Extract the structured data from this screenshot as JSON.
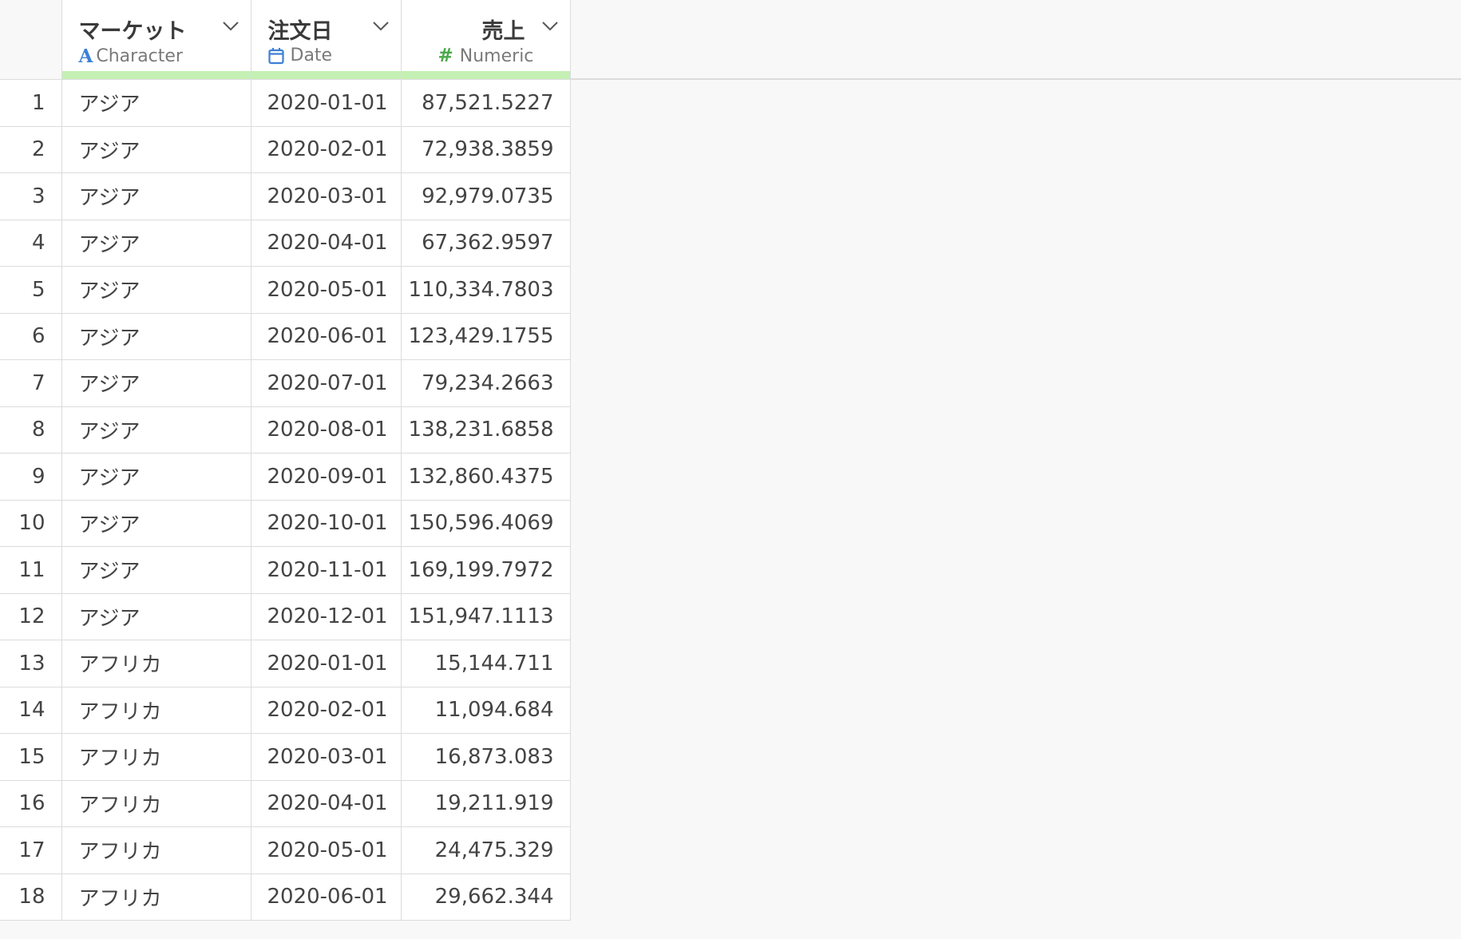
{
  "columns": [
    {
      "title": "マーケット",
      "type_label": "Character",
      "type_icon": "character-type-icon",
      "align": "left"
    },
    {
      "title": "注文日",
      "type_label": "Date",
      "type_icon": "calendar-icon",
      "align": "left"
    },
    {
      "title": "売上",
      "type_label": "Numeric",
      "type_icon": "hash-icon",
      "align": "right"
    }
  ],
  "colors": {
    "quality_bar": "#c4f0b4",
    "character_icon": "#3c7fd6",
    "date_icon": "#3c7fd6",
    "numeric_icon": "#4aa84a"
  },
  "rows": [
    {
      "n": "1",
      "market": "アジア",
      "date": "2020-01-01",
      "sales": "87,521.5227"
    },
    {
      "n": "2",
      "market": "アジア",
      "date": "2020-02-01",
      "sales": "72,938.3859"
    },
    {
      "n": "3",
      "market": "アジア",
      "date": "2020-03-01",
      "sales": "92,979.0735"
    },
    {
      "n": "4",
      "market": "アジア",
      "date": "2020-04-01",
      "sales": "67,362.9597"
    },
    {
      "n": "5",
      "market": "アジア",
      "date": "2020-05-01",
      "sales": "110,334.7803"
    },
    {
      "n": "6",
      "market": "アジア",
      "date": "2020-06-01",
      "sales": "123,429.1755"
    },
    {
      "n": "7",
      "market": "アジア",
      "date": "2020-07-01",
      "sales": "79,234.2663"
    },
    {
      "n": "8",
      "market": "アジア",
      "date": "2020-08-01",
      "sales": "138,231.6858"
    },
    {
      "n": "9",
      "market": "アジア",
      "date": "2020-09-01",
      "sales": "132,860.4375"
    },
    {
      "n": "10",
      "market": "アジア",
      "date": "2020-10-01",
      "sales": "150,596.4069"
    },
    {
      "n": "11",
      "market": "アジア",
      "date": "2020-11-01",
      "sales": "169,199.7972"
    },
    {
      "n": "12",
      "market": "アジア",
      "date": "2020-12-01",
      "sales": "151,947.1113"
    },
    {
      "n": "13",
      "market": "アフリカ",
      "date": "2020-01-01",
      "sales": "15,144.711"
    },
    {
      "n": "14",
      "market": "アフリカ",
      "date": "2020-02-01",
      "sales": "11,094.684"
    },
    {
      "n": "15",
      "market": "アフリカ",
      "date": "2020-03-01",
      "sales": "16,873.083"
    },
    {
      "n": "16",
      "market": "アフリカ",
      "date": "2020-04-01",
      "sales": "19,211.919"
    },
    {
      "n": "17",
      "market": "アフリカ",
      "date": "2020-05-01",
      "sales": "24,475.329"
    },
    {
      "n": "18",
      "market": "アフリカ",
      "date": "2020-06-01",
      "sales": "29,662.344"
    }
  ]
}
